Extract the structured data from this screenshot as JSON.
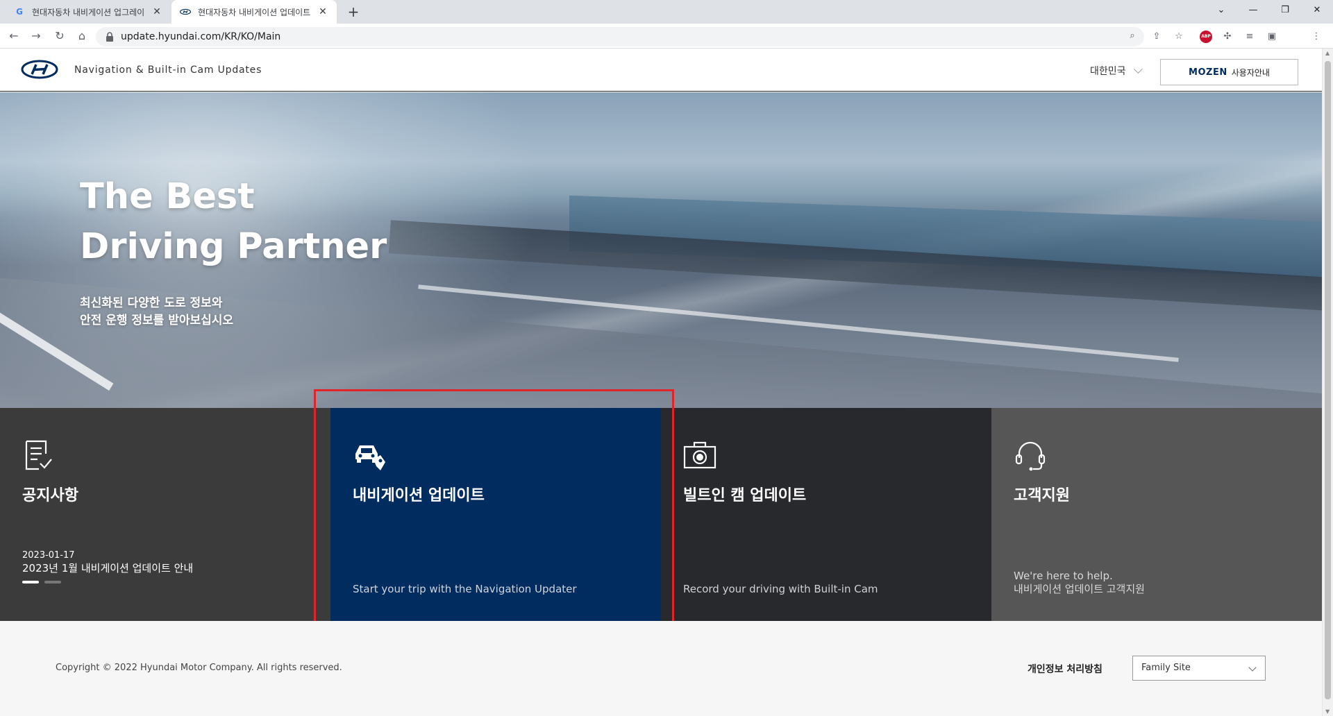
{
  "browser": {
    "tabs": [
      {
        "title": "현대자동차 내비게이션 업그레이",
        "favicon": "G",
        "active": false
      },
      {
        "title": "현대자동차 내비게이션 업데이트",
        "favicon": "H",
        "active": true
      }
    ],
    "new_tab_label": "+",
    "url": "update.hyundai.com/KR/KO/Main",
    "window_controls": [
      "⌄",
      "—",
      "❐",
      "✕"
    ],
    "extensions_label": "ABP"
  },
  "header": {
    "subtitle": "Navigation & Built-in Cam Updates",
    "region": "대한민국",
    "mozen_brand": "MOZEN",
    "mozen_label": "사용자안내"
  },
  "hero": {
    "title_line1": "The Best",
    "title_line2": "Driving Partner",
    "desc_line1": "최신화된 다양한 도로 정보와",
    "desc_line2": "안전 운행 정보를 받아보십시오"
  },
  "tiles": {
    "notice": {
      "name": "공지사항",
      "date": "2023-01-17",
      "title": "2023년 1월 내비게이션 업데이트 안내"
    },
    "navigation": {
      "name": "내비게이션 업데이트",
      "sub": "Start your trip with the Navigation Updater"
    },
    "builtin_cam": {
      "name": "빌트인 캠 업데이트",
      "sub": "Record your driving with Built-in Cam"
    },
    "support": {
      "name": "고객지원",
      "sub_line1": "We're here to help.",
      "sub_line2": "내비게이션 업데이트 고객지원"
    }
  },
  "footer": {
    "copyright": "Copyright © 2022 Hyundai Motor Company. All rights reserved.",
    "privacy": "개인정보 처리방침",
    "family_site": "Family Site"
  },
  "colors": {
    "brand_navy": "#002c5f",
    "highlight_red": "#e0242a"
  }
}
